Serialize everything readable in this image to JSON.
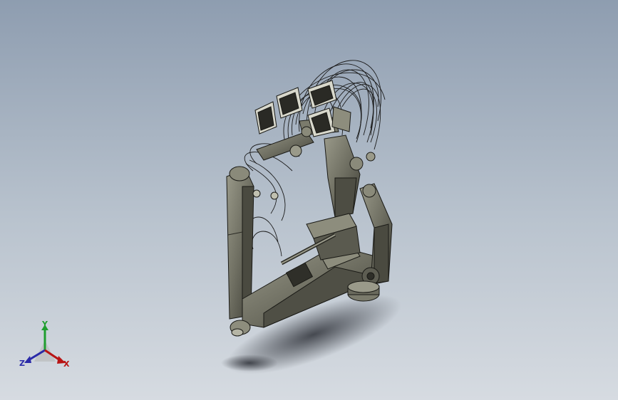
{
  "viewport": {
    "background_top": "#8e9db0",
    "background_bottom": "#d6dbe1",
    "model_color": "#6f6f62",
    "shadow_color": "#3c4048"
  },
  "triad": {
    "y_label": "Y",
    "z_label": "Z",
    "x_label": "X",
    "y_color": "#1f9e2f",
    "z_color": "#2a2aa8",
    "x_color": "#b81414"
  }
}
